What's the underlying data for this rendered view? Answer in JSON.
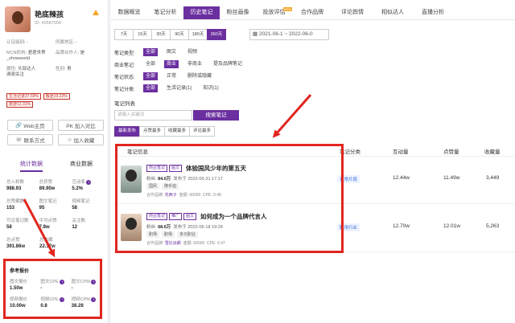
{
  "profile": {
    "name": "艳底辣孩",
    "uid": "ID: 40587606"
  },
  "info": [
    [
      "认证级别",
      "-",
      "所属地区",
      "-"
    ],
    [
      "MCN机构",
      "君君世界",
      "品牌合作人",
      "是"
    ],
    [
      "",
      "_showworld",
      "",
      ""
    ],
    [
      "属性",
      "头部达人",
      "性别",
      "男"
    ],
    [
      "",
      "谢谢关注",
      "",
      ""
    ]
  ],
  "tags": [
    "生活记录37.69%",
    "搬迷19.23%",
    "旅游12.31%"
  ],
  "actions": {
    "web": "Web主页",
    "compare": "PK 加入对比",
    "contact": "联系方式",
    "collect": "加入收藏"
  },
  "stat_tabs": [
    "统计数据",
    "商业数据"
  ],
  "stats": [
    [
      [
        "总入粉数",
        "988.93"
      ],
      [
        "总获赞",
        "89.90w"
      ],
      [
        "互动率",
        "5.2%"
      ]
    ],
    [
      [
        "总赞藏数",
        "153"
      ],
      [
        "图文笔记",
        "95"
      ],
      [
        "视频笔记",
        "58"
      ]
    ],
    [
      [
        "可见笔记数",
        "58"
      ],
      [
        "平均点赞",
        "7.8w"
      ],
      [
        "关注数",
        "12"
      ]
    ],
    [
      [
        "总点赞",
        "391.86w"
      ],
      [
        "总收藏",
        "22.17w"
      ],
      [
        "",
        ""
      ]
    ]
  ],
  "ref_price": {
    "title": "参考报价",
    "items": [
      [
        "图文报价",
        "1.50w"
      ],
      [
        "图文CPE",
        "-"
      ],
      [
        "图文CPM",
        "-"
      ],
      [
        "视频报价",
        "10.00w"
      ],
      [
        "视频CPE",
        "0.8"
      ],
      [
        "视频CPM",
        "38.28"
      ]
    ]
  },
  "tabs": [
    "数据概览",
    "笔记分析",
    "历史笔记",
    "粉丝画像",
    "投放评估",
    "合作品牌",
    "评论舆情",
    "相似达人",
    "直播分析"
  ],
  "new_badge": "NEW",
  "date_buttons": [
    "7天",
    "15天",
    "30天",
    "90天",
    "180天",
    "360天"
  ],
  "date_range": "2021-06-1 ~ 2022-06-0",
  "filters": [
    {
      "label": "笔记类型:",
      "options": [
        "全部",
        "图文",
        "视频"
      ]
    },
    {
      "label": "商业笔记:",
      "options": [
        "全部",
        "商业",
        "非商业",
        "提及品牌笔记"
      ]
    },
    {
      "label": "笔记状态:",
      "options": [
        "全部",
        "正常",
        "删除或隐藏"
      ]
    },
    {
      "label": "笔记分类:",
      "options": [
        "全部",
        "生活记录(1)",
        "知识(1)"
      ]
    }
  ],
  "list_title": "笔记列表",
  "search": {
    "placeholder": "请输入关键词",
    "button": "搜索笔记"
  },
  "sorts": [
    "最新发布",
    "点赞最多",
    "收藏最多",
    "评论最多"
  ],
  "table": {
    "headers": [
      "笔记信息",
      "笔记分类",
      "互动量",
      "点赞量",
      "收藏量"
    ],
    "rows": [
      {
        "tags": [
          "商业笔记",
          "图文"
        ],
        "title": "体验国风少年的第五天",
        "fans_label": "粉丝:",
        "fans": "84.0万",
        "date": "发布于 2022-05-31 17:17",
        "chips": [
          "国风",
          "随手拍"
        ],
        "partner_label": "合作品牌:",
        "partner": "花西子",
        "price": "金额: 60000",
        "cpe": "CPE: 0.48",
        "category": "日常片段",
        "interact": "12.44w",
        "likes": "11.49w",
        "collects": "3,449"
      },
      {
        "tags": [
          "商业笔记",
          "推广",
          "图文"
        ],
        "title": "如何成为一个品牌代言人",
        "fans_label": "粉丝:",
        "fans": "68.6万",
        "date": "发布于 2022-05-18 19:28",
        "chips": [
          "职场",
          "职场",
          "多元职业"
        ],
        "partner_label": "合作品牌:",
        "partner": "雪比派朗",
        "price": "金额: 60000",
        "cpe": "CPE: 0.47",
        "category": "职场行业",
        "interact": "12.70w",
        "likes": "12.01w",
        "collects": "5,263"
      }
    ]
  },
  "colors": {
    "accent": "#6b2fa0",
    "highlight": "#e0261f"
  }
}
